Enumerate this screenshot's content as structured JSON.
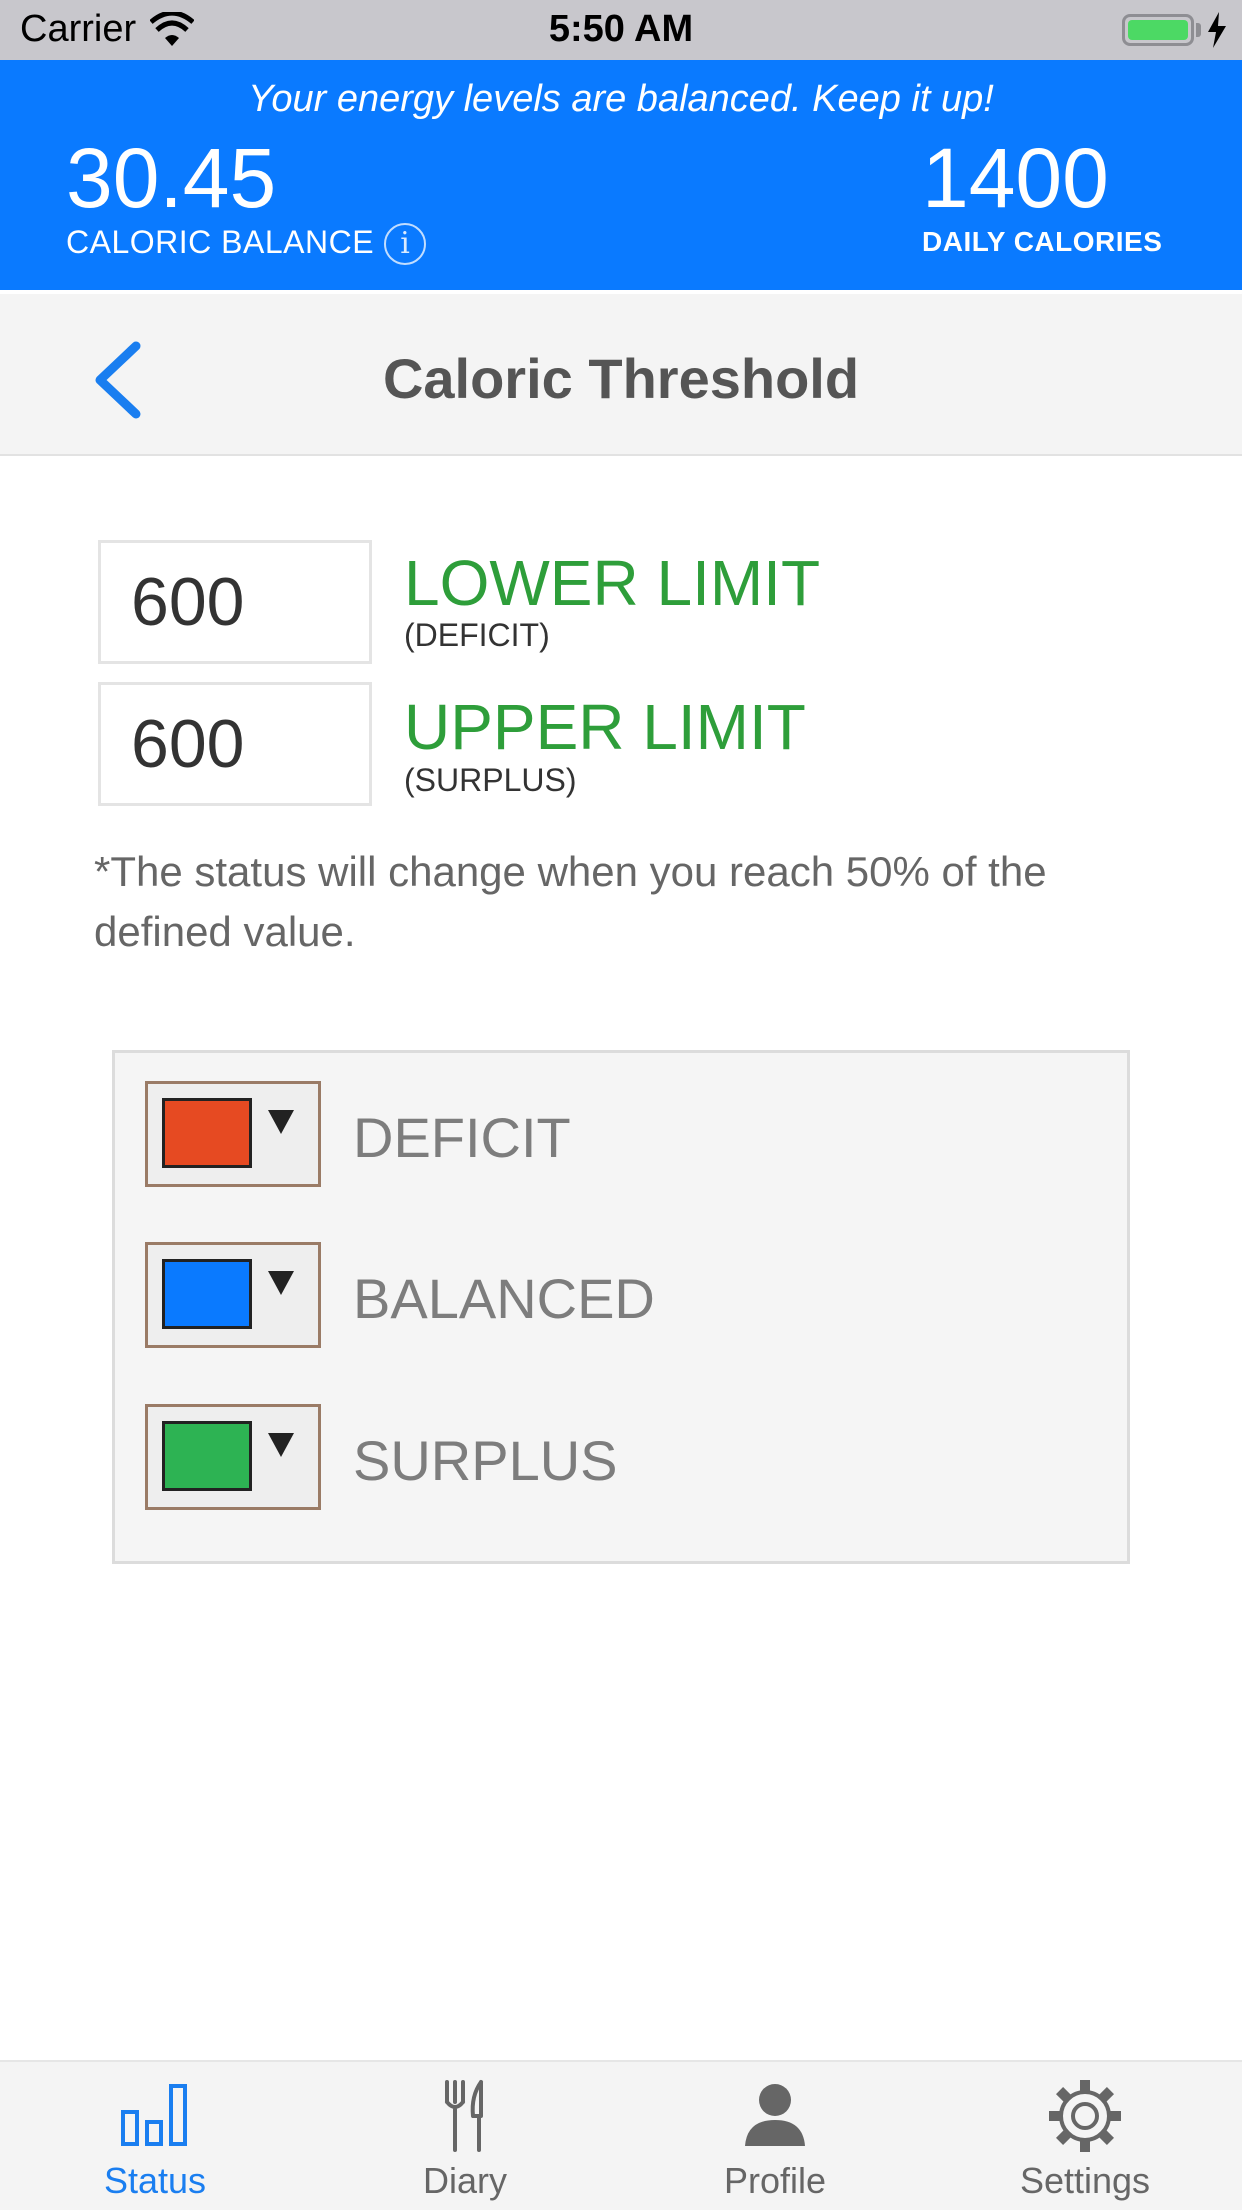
{
  "status_bar": {
    "carrier": "Carrier",
    "time": "5:50 AM"
  },
  "banner": {
    "message": "Your energy levels are balanced. Keep it up!",
    "balance_value": "30.45",
    "balance_label": "CALORIC BALANCE",
    "info_glyph": "i",
    "daily_value": "1400",
    "daily_label": "DAILY CALORIES"
  },
  "nav": {
    "title": "Caloric Threshold"
  },
  "limits": {
    "lower": {
      "value": "600",
      "title": "LOWER LIMIT",
      "sub": "(DEFICIT)"
    },
    "upper": {
      "value": "600",
      "title": "UPPER LIMIT",
      "sub": "(SURPLUS)"
    }
  },
  "note": "*The status will change when you reach 50% of the defined value.",
  "colors": {
    "items": [
      {
        "label": "DEFICIT",
        "color": "#e64a22"
      },
      {
        "label": "BALANCED",
        "color": "#0a7aff"
      },
      {
        "label": "SURPLUS",
        "color": "#2db353"
      }
    ]
  },
  "tabs": [
    {
      "label": "Status",
      "icon": "bar-chart-icon",
      "active": true
    },
    {
      "label": "Diary",
      "icon": "fork-knife-icon",
      "active": false
    },
    {
      "label": "Profile",
      "icon": "person-icon",
      "active": false
    },
    {
      "label": "Settings",
      "icon": "gear-icon",
      "active": false
    }
  ]
}
